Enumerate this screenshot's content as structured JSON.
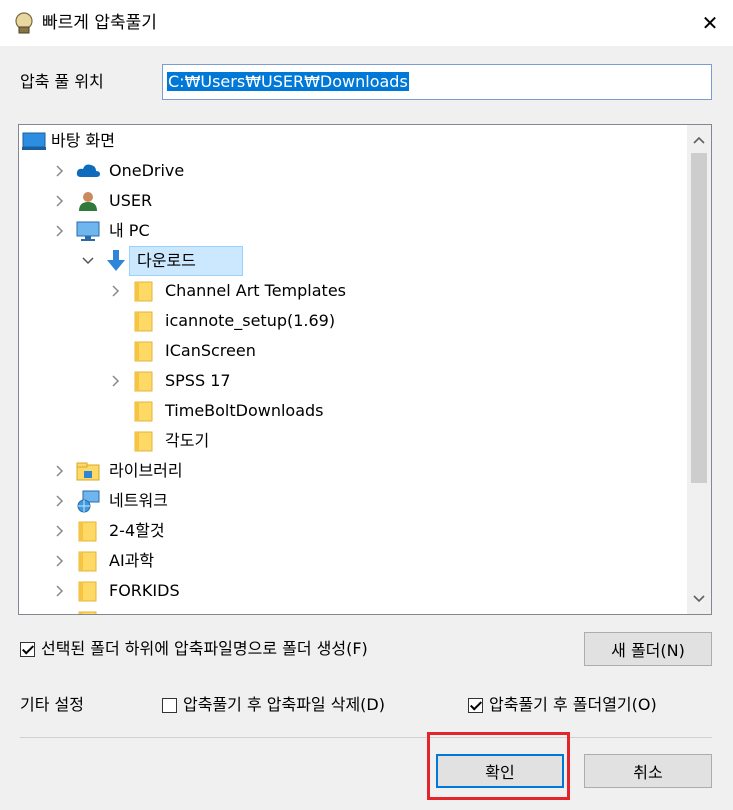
{
  "window": {
    "title": "빠르게 압축풀기",
    "close_symbol": "✕"
  },
  "location": {
    "label": "압축 풀 위치",
    "value": "C:₩Users₩USER₩Downloads"
  },
  "tree": {
    "items": [
      {
        "label": "바탕 화면",
        "icon": "desktop-icon",
        "level": 0,
        "expander": "none"
      },
      {
        "label": "OneDrive",
        "icon": "cloud-icon",
        "level": 1,
        "expander": "collapsed"
      },
      {
        "label": "USER",
        "icon": "user-icon",
        "level": 1,
        "expander": "collapsed"
      },
      {
        "label": "내 PC",
        "icon": "computer-icon",
        "level": 1,
        "expander": "collapsed"
      },
      {
        "label": "다운로드",
        "icon": "download-icon",
        "level": 2,
        "expander": "expanded",
        "selected": true
      },
      {
        "label": "Channel Art Templates",
        "icon": "folder-icon",
        "level": 3,
        "expander": "collapsed"
      },
      {
        "label": "icannote_setup(1.69)",
        "icon": "folder-icon",
        "level": 3,
        "expander": "none"
      },
      {
        "label": "ICanScreen",
        "icon": "folder-icon",
        "level": 3,
        "expander": "none"
      },
      {
        "label": "SPSS 17",
        "icon": "folder-icon",
        "level": 3,
        "expander": "collapsed"
      },
      {
        "label": "TimeBoltDownloads",
        "icon": "folder-icon",
        "level": 3,
        "expander": "none"
      },
      {
        "label": "각도기",
        "icon": "folder-icon",
        "level": 3,
        "expander": "none"
      },
      {
        "label": "라이브러리",
        "icon": "library-icon",
        "level": 1,
        "expander": "collapsed"
      },
      {
        "label": "네트워크",
        "icon": "network-icon",
        "level": 1,
        "expander": "collapsed"
      },
      {
        "label": "2-4할것",
        "icon": "folder-icon",
        "level": 1,
        "expander": "collapsed"
      },
      {
        "label": "AI과학",
        "icon": "folder-icon",
        "level": 1,
        "expander": "collapsed"
      },
      {
        "label": "FORKIDS",
        "icon": "folder-icon",
        "level": 1,
        "expander": "collapsed"
      },
      {
        "label": "",
        "icon": "folder-icon",
        "level": 1,
        "expander": "collapsed"
      }
    ],
    "scroll_up": "⌃",
    "scroll_down": "⌄"
  },
  "options": {
    "create_folder_label": "선택된 폴더 하위에 압축파일명으로 폴더 생성(F)",
    "create_folder_checked": true,
    "new_folder_button": "새 폴더(N)",
    "misc_label": "기타 설정",
    "delete_after_label": "압축풀기 후 압축파일 삭제(D)",
    "delete_after_checked": false,
    "open_folder_label": "압축풀기 후 폴더열기(O)",
    "open_folder_checked": true
  },
  "buttons": {
    "ok": "확인",
    "cancel": "취소"
  },
  "colors": {
    "selection": "#0078d7",
    "highlight_box": "#e3242b",
    "folder": "#ffd966"
  }
}
